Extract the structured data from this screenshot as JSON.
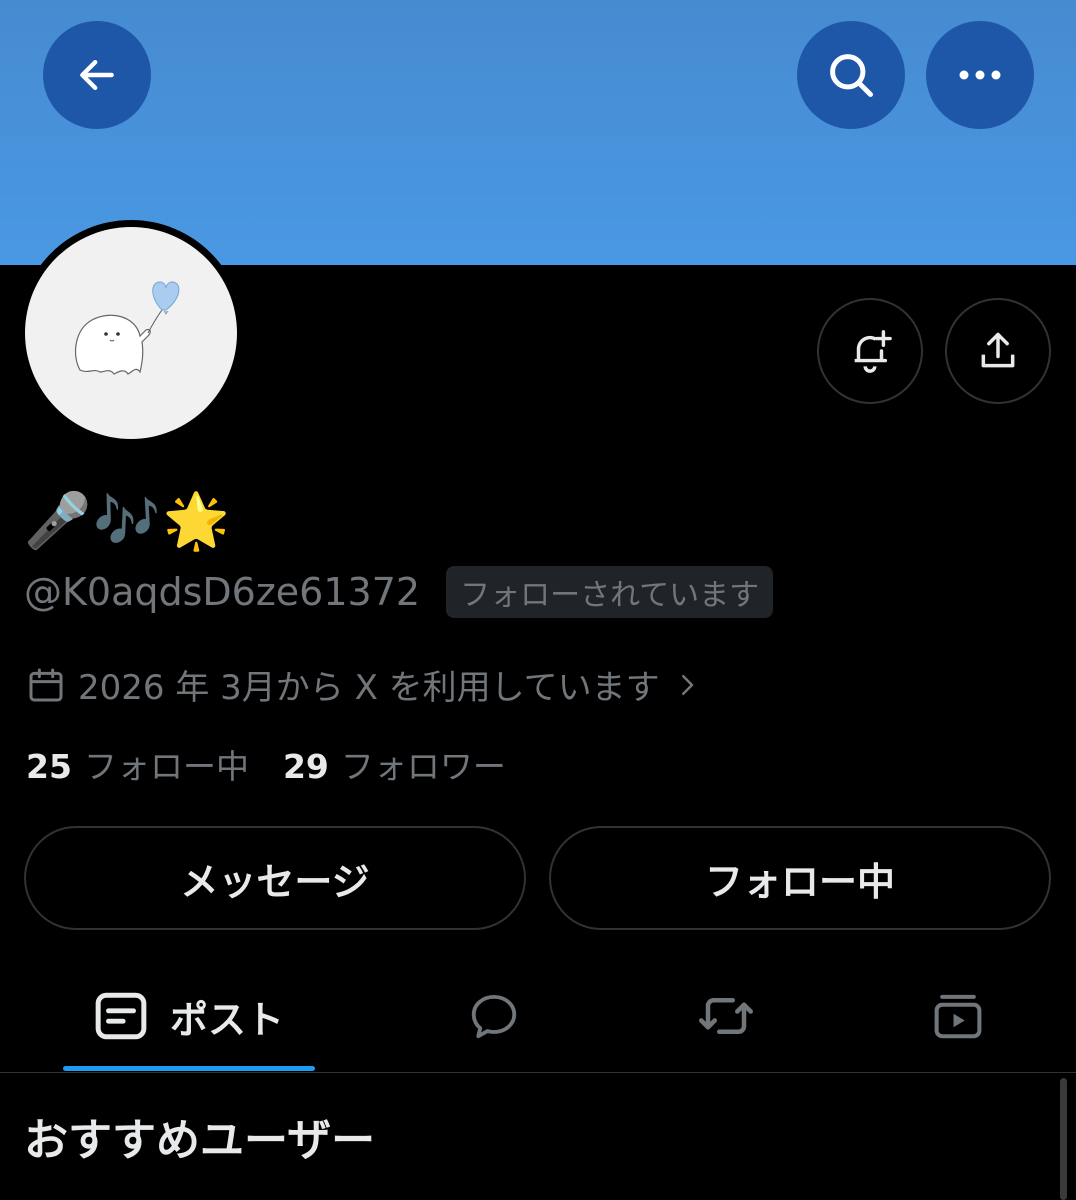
{
  "profile": {
    "display_name": "🎤🎶🌟",
    "handle": "@K0aqdsD6ze61372",
    "follows_you_badge": "フォローされています",
    "joined_text": "2026 年 3月から X を利用しています",
    "following_count": "25",
    "following_label": "フォロー中",
    "followers_count": "29",
    "followers_label": "フォロワー"
  },
  "actions": {
    "message_label": "メッセージ",
    "following_button_label": "フォロー中"
  },
  "tabs": [
    {
      "label": "ポスト",
      "icon": "posts-icon",
      "active": true
    },
    {
      "label": "",
      "icon": "replies-icon"
    },
    {
      "label": "",
      "icon": "reposts-icon"
    },
    {
      "label": "",
      "icon": "media-icon"
    }
  ],
  "recommended": {
    "title": "おすすめユーザー"
  },
  "colors": {
    "banner": "#4a98e4",
    "banner_button": "#1f57a8",
    "accent": "#1d9bf0",
    "muted_text": "#71767b"
  }
}
